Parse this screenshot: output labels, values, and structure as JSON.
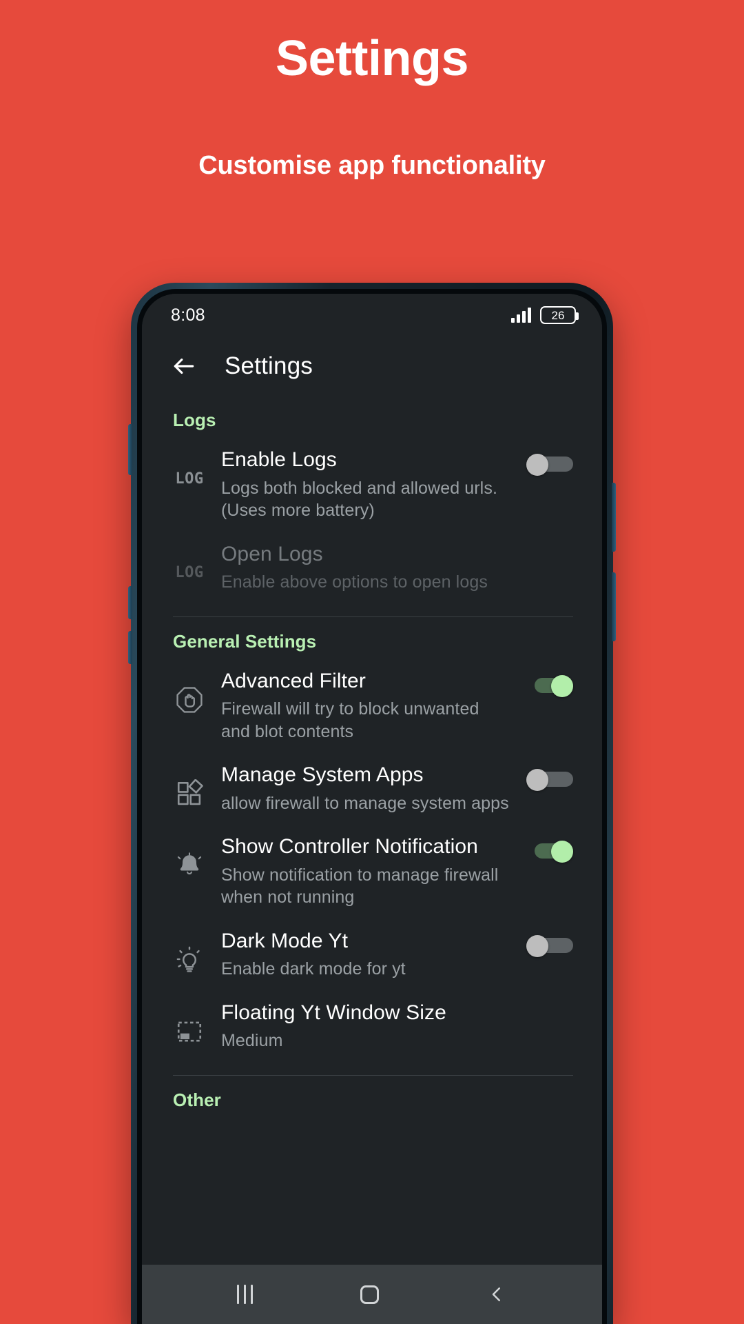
{
  "promo": {
    "title": "Settings",
    "subtitle": "Customise app functionality",
    "background_color": "#e64a3c"
  },
  "phone": {
    "statusbar": {
      "time": "8:08",
      "signal_icon": "signal-bars-icon",
      "signal_bars": 4,
      "battery_icon": "battery-icon",
      "battery_level": "26"
    },
    "appbar": {
      "back_icon": "back-arrow-icon",
      "title": "Settings"
    },
    "accent_color": "#b9f0b3",
    "sections": [
      {
        "header": "Logs",
        "items": [
          {
            "icon": "log-icon",
            "icon_text": "LOG",
            "title": "Enable Logs",
            "subtitle": "Logs both blocked and allowed urls. (Uses more battery)",
            "control": "switch",
            "state": "off",
            "disabled": false
          },
          {
            "icon": "log-icon",
            "icon_text": "LOG",
            "title": "Open Logs",
            "subtitle": "Enable above options to open logs",
            "control": "none",
            "state": "",
            "disabled": true
          }
        ]
      },
      {
        "header": "General Settings",
        "items": [
          {
            "icon": "block-hand-icon",
            "icon_text": "",
            "title": "Advanced Filter",
            "subtitle": "Firewall will try to block unwanted and blot contents",
            "control": "switch",
            "state": "on",
            "disabled": false
          },
          {
            "icon": "system-apps-grid-icon",
            "icon_text": "",
            "title": "Manage System Apps",
            "subtitle": "allow firewall to manage system apps",
            "control": "switch",
            "state": "off",
            "disabled": false
          },
          {
            "icon": "bell-icon",
            "icon_text": "",
            "title": "Show Controller Notification",
            "subtitle": "Show notification to manage firewall when not running",
            "control": "switch",
            "state": "on",
            "disabled": false
          },
          {
            "icon": "lightbulb-icon",
            "icon_text": "",
            "title": "Dark Mode Yt",
            "subtitle": "Enable dark mode for yt",
            "control": "switch",
            "state": "off",
            "disabled": false
          },
          {
            "icon": "resize-window-icon",
            "icon_text": "",
            "title": "Floating Yt Window Size",
            "subtitle": "Medium",
            "control": "none",
            "state": "",
            "disabled": false
          }
        ]
      },
      {
        "header": "Other",
        "items": []
      }
    ],
    "navbar": {
      "recents_icon": "recents-icon",
      "home_icon": "home-icon",
      "back_icon": "nav-back-icon"
    }
  }
}
